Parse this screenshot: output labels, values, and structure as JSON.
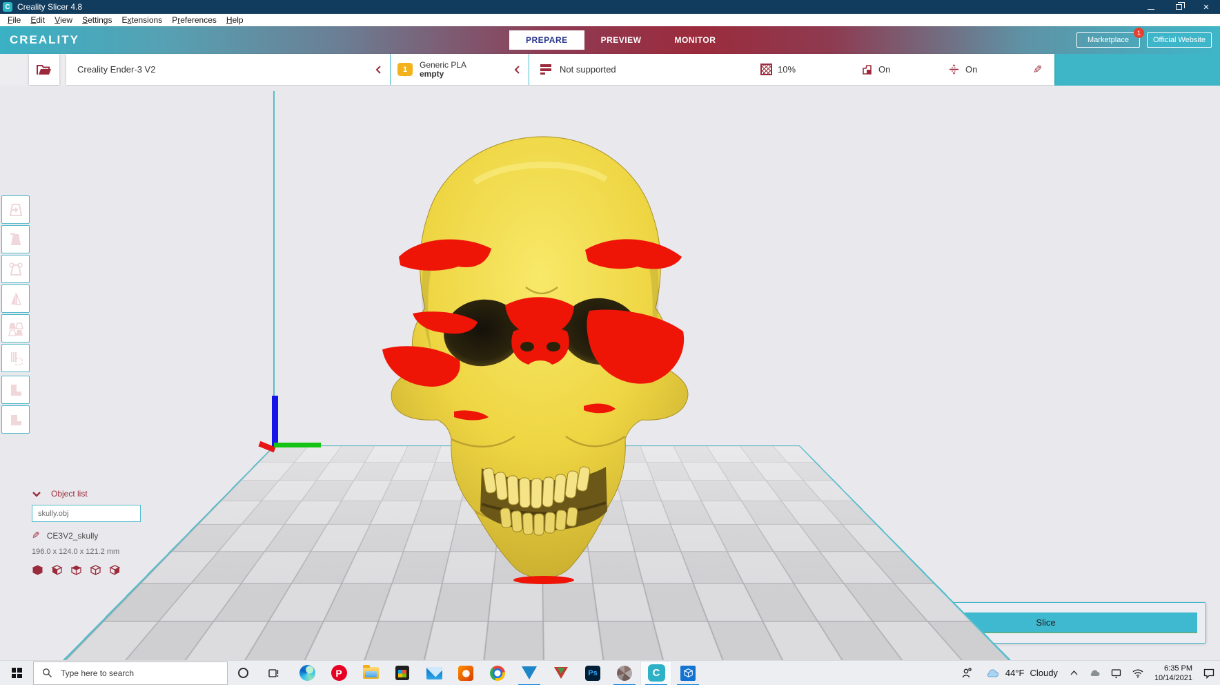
{
  "window": {
    "title": "Creality Slicer 4.8"
  },
  "menu_bar": {
    "items": [
      {
        "pre": "",
        "u": "F",
        "post": "ile"
      },
      {
        "pre": "",
        "u": "E",
        "post": "dit"
      },
      {
        "pre": "",
        "u": "V",
        "post": "iew"
      },
      {
        "pre": "",
        "u": "S",
        "post": "ettings"
      },
      {
        "pre": "E",
        "u": "x",
        "post": "tensions"
      },
      {
        "pre": "P",
        "u": "r",
        "post": "eferences"
      },
      {
        "pre": "",
        "u": "H",
        "post": "elp"
      }
    ]
  },
  "header": {
    "brand": "CREALITY",
    "tabs": [
      {
        "label": "PREPARE",
        "active": true
      },
      {
        "label": "PREVIEW",
        "active": false
      },
      {
        "label": "MONITOR",
        "active": false
      }
    ],
    "marketplace": {
      "label": "Marketplace",
      "badge": "1"
    },
    "official_website": "Official Website"
  },
  "toolbar": {
    "printer_name": "Creality Ender-3 V2",
    "material": {
      "slot": "1",
      "name": "Generic PLA",
      "status": "empty"
    },
    "profile_status": "Not supported",
    "infill": "10%",
    "support": "On",
    "adhesion": "On",
    "icons": [
      "open-file-icon",
      "material-pin-icon",
      "profile-layers-icon",
      "infill-icon",
      "support-icon",
      "adhesion-icon",
      "edit-pencil-icon"
    ]
  },
  "sidebar": {
    "tools": [
      "move-tool",
      "scale-tool",
      "rotate-tool",
      "mirror-tool",
      "per-model-settings-tool",
      "support-blocker-tool",
      "model-block-tool-1",
      "model-block-tool-2"
    ]
  },
  "object_list": {
    "title": "Object list",
    "file_name": "skully.obj",
    "model_name": "CE3V2_skully",
    "dimensions": "196.0 x 124.0 x 121.2 mm",
    "view_icons": [
      "view-3d-icon",
      "view-front-icon",
      "view-top-icon",
      "view-left-icon",
      "view-right-icon"
    ]
  },
  "slice": {
    "label": "Slice"
  },
  "taskbar": {
    "search_placeholder": "Type here to search",
    "apps": [
      "edge",
      "pinterest",
      "file-explorer",
      "microsoft-store",
      "mail",
      "office",
      "chrome",
      "triangle-app-blue",
      "triangle-app-red",
      "photoshop",
      "meshmixer",
      "creality-slicer",
      "3d-viewer"
    ],
    "active_apps": [
      "triangle-app-blue",
      "meshmixer",
      "creality-slicer",
      "3d-viewer"
    ],
    "weather": {
      "temp": "44°F",
      "condition": "Cloudy"
    },
    "clock": {
      "time": "6:35 PM",
      "date": "10/14/2021"
    }
  },
  "colors": {
    "titlebar": "#123c5e",
    "accent_teal": "#3db7cd",
    "accent_maroon": "#9b2b3c",
    "active_tab_text": "#27348b",
    "model_yellow": "#eed542",
    "overhang_red": "#ee1507",
    "taskbar_underline": "#0078d7",
    "material_pin": "#f3b21d"
  }
}
